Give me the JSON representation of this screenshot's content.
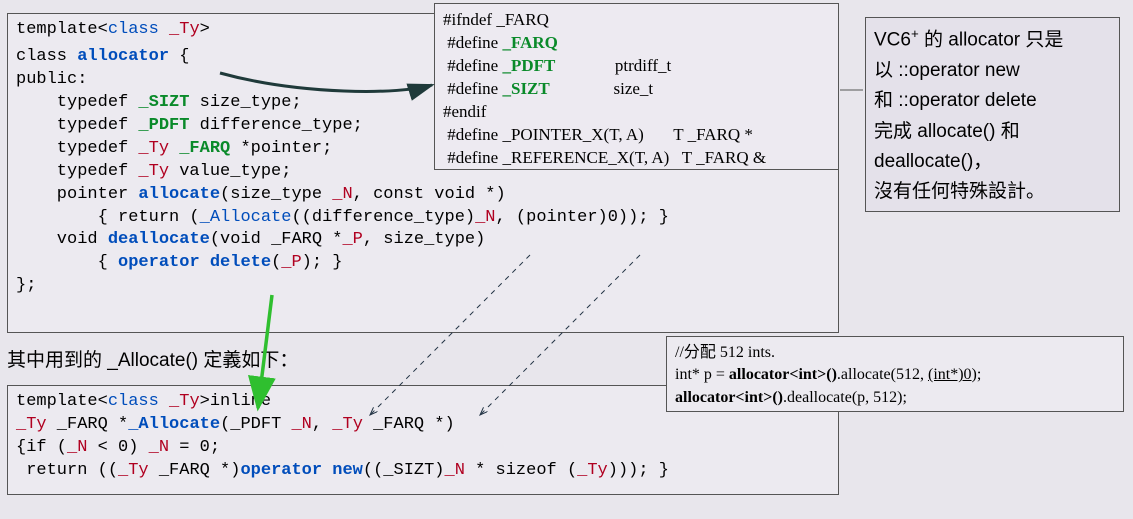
{
  "mainCode": {
    "l1a": "template<",
    "l1b": "class",
    "l1c": " ",
    "l1d": "_Ty",
    "l1e": ">",
    "l2a": "class ",
    "l2b": "allocator",
    "l2c": " {",
    "l3": "public:",
    "l4a": "    typedef ",
    "l4b": "_SIZT",
    "l4c": " size_type;",
    "l5a": "    typedef ",
    "l5b": "_PDFT",
    "l5c": " difference_type;",
    "l6a": "    typedef ",
    "l6b": "_Ty",
    "l6c": " ",
    "l6d": "_FARQ",
    "l6e": " *pointer;",
    "l7a": "    typedef ",
    "l7b": "_Ty",
    "l7c": " value_type;",
    "l8a": "    pointer ",
    "l8b": "allocate",
    "l8c": "(size_type ",
    "l8d": "_N",
    "l8e": ", const void *)",
    "l9a": "        { return (",
    "l9b": "_Allocate",
    "l9c": "((difference_type)",
    "l9d": "_N",
    "l9e": ", (pointer)0)); }",
    "l10a": "    void ",
    "l10b": "deallocate",
    "l10c": "(void _FARQ *",
    "l10d": "_P",
    "l10e": ", size_type)",
    "l11a": "        { ",
    "l11b": "operator delete",
    "l11c": "(",
    "l11d": "_P",
    "l11e": "); }",
    "l12": "};"
  },
  "defines": {
    "l1": "#ifndef _FARQ",
    "l2a": " #define ",
    "l2b": "_FARQ",
    "l3a": " #define ",
    "l3b": "_PDFT",
    "l3c": "              ptrdiff_t",
    "l4a": " #define ",
    "l4b": "_SIZT",
    "l4c": "               size_t",
    "l5": "#endif",
    "l6": " #define _POINTER_X(T, A)       T _FARQ *",
    "l7": " #define _REFERENCE_X(T, A)   T _FARQ &"
  },
  "midText": "其中用到的 _Allocate() 定義如下：",
  "allocCode": {
    "l1a": "template<",
    "l1b": "class",
    "l1c": " ",
    "l1d": "_Ty",
    "l1e": ">inline",
    "l2a": "_Ty",
    "l2b": " _FARQ *",
    "l2c": "_Allocate",
    "l2d": "(_PDFT ",
    "l2e": "_N",
    "l2f": ", ",
    "l2g": "_Ty",
    "l2h": " _FARQ *)",
    "l3a": "{if (",
    "l3b": "_N",
    "l3c": " < 0) ",
    "l3d": "_N",
    "l3e": " = 0;",
    "l4a": " return ((",
    "l4b": "_Ty",
    "l4c": " _FARQ *)",
    "l4d": "operator new",
    "l4e": "((_SIZT)",
    "l4f": "_N",
    "l4g": " * sizeof (",
    "l4h": "_Ty",
    "l4i": "))); }"
  },
  "note": {
    "l1a": "VC6",
    "l1b": "+",
    "l1c": " 的 allocator 只是",
    "l2": "以 ::operator new",
    "l3": "和 ::operator delete",
    "l4": "完成 allocate() 和",
    "l5": "deallocate()，",
    "l6": "沒有任何特殊設計。"
  },
  "usage": {
    "l1": "//分配 512 ints.",
    "l2a": "int* p = ",
    "l2b": "allocator<int>()",
    "l2c": ".allocate(512, ",
    "l2d": "(int*)0",
    "l2e": ");",
    "l3a": "allocator<int>()",
    "l3b": ".deallocate(p, 512);"
  }
}
